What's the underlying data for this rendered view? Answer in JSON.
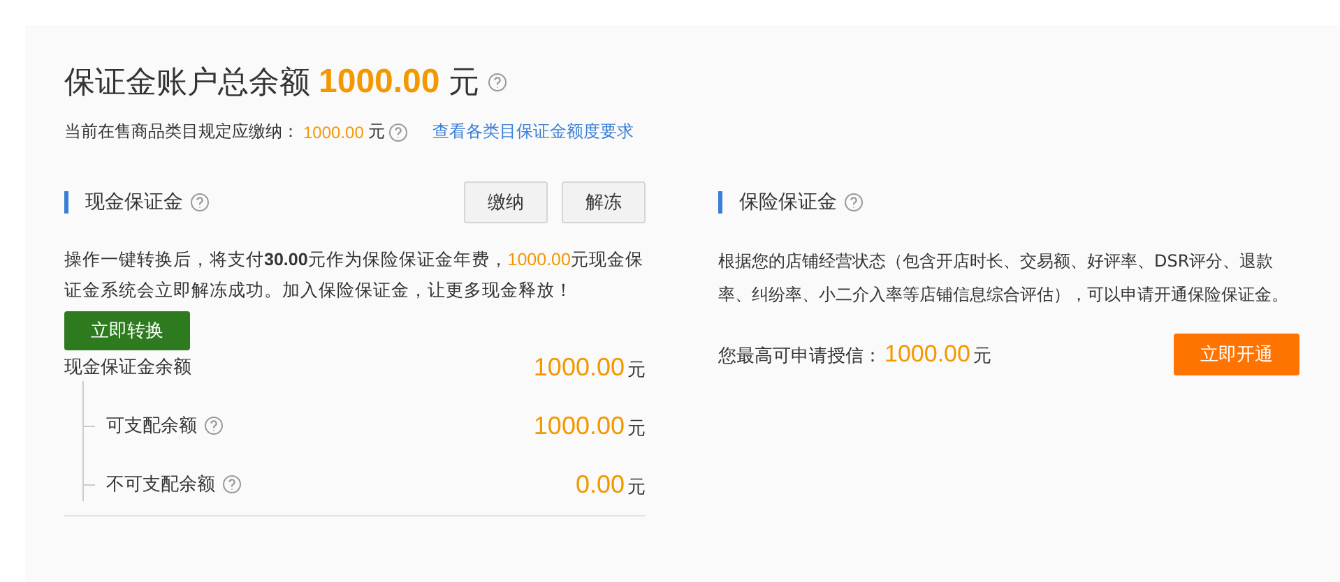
{
  "header": {
    "title": "保证金账户总余额",
    "amount": "1000.00",
    "unit": "元",
    "required_label": "当前在售商品类目规定应缴纳：",
    "required_amount": "1000.00",
    "required_unit": "元",
    "link": "查看各类目保证金额度要求"
  },
  "cash": {
    "title": "现金保证金",
    "buttons": [
      "缴纳",
      "解冻"
    ],
    "description": [
      {
        "text": "操作一键转换后，将支付",
        "kind": "plain"
      },
      {
        "text": "30.00",
        "kind": "bold"
      },
      {
        "text": "元作为保险保证金年费，",
        "kind": "plain"
      },
      {
        "text": "1000.00",
        "kind": "amount"
      },
      {
        "text": "元现金保证金系统会立即解冻成功。加入保险保证金，让更多现金释放！",
        "kind": "plain"
      }
    ],
    "convert_button": "立即转换",
    "balance": {
      "label": "现金保证金余额",
      "amount": "1000.00",
      "unit": "元",
      "children": [
        {
          "label": "可支配余额",
          "amount": "1000.00",
          "unit": "元"
        },
        {
          "label": "不可支配余额",
          "amount": "0.00",
          "unit": "元"
        }
      ]
    }
  },
  "insurance": {
    "title": "保险保证金",
    "description": "根据您的店铺经营状态（包含开店时长、交易额、好评率、DSR评分、退款率、纠纷率、小二介入率等店铺信息综合评估），可以申请开通保险保证金。",
    "credit_label": "您最高可申请授信：",
    "credit_amount": "1000.00",
    "credit_unit": "元",
    "open_button": "立即开通"
  }
}
